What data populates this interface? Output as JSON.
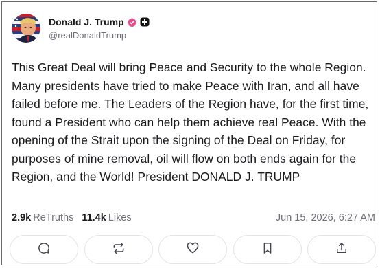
{
  "author": {
    "display_name": "Donald J. Trump",
    "handle": "@realDonaldTrump",
    "avatar_icon": "user-avatar-image",
    "verified_icon": "verified-badge-icon",
    "verified_color": "#e64a8a",
    "badge_icon": "plus-square-icon"
  },
  "post": {
    "text": "This Great Deal will bring Peace and Security to the whole Region. Many presidents have tried to make Peace with Iran, and all have failed before me. The Leaders of the Region have, for the first time, found a President who can help them achieve real Peace. With the opening of the Strait upon the signing of the Deal on Friday, for purposes of mine removal, oil will flow on both ends again for the Region, and the World! President DONALD J. TRUMP"
  },
  "stats": {
    "retruths_count": "2.9k",
    "retruths_label": "ReTruths",
    "likes_count": "11.4k",
    "likes_label": "Likes",
    "timestamp": "Jun 15, 2026, 6:27 AM"
  },
  "actions": [
    {
      "icon": "reply-icon"
    },
    {
      "icon": "retruth-icon"
    },
    {
      "icon": "like-heart-icon"
    },
    {
      "icon": "bookmark-icon"
    },
    {
      "icon": "share-icon"
    }
  ],
  "colors": {
    "text": "#1b1b1f",
    "muted": "#6e6e78",
    "button_border": "#e3e3e8"
  }
}
